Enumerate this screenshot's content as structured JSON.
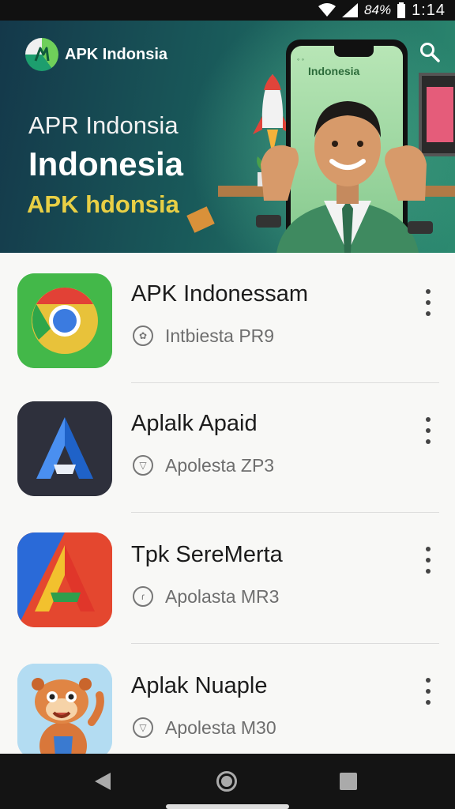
{
  "status_bar": {
    "battery": "84%",
    "time": "1:14"
  },
  "banner": {
    "brand": "APK Indonsia",
    "line1": "APR Indonsia",
    "line2": "Indonesia",
    "line3": "APK hdonsia",
    "phone_brand": "Indonesia",
    "accent": "#e8cf45"
  },
  "apps": [
    {
      "title": "APK Indonessam",
      "subtitle": "Intbiesta PR9",
      "icon": "chrome-icon"
    },
    {
      "title": "Aplalk Apaid",
      "subtitle": "Apolesta ZP3",
      "icon": "letter-a-blue-icon"
    },
    {
      "title": "Tpk SereMerta",
      "subtitle": "Apolasta MR3",
      "icon": "letter-a-multicolor-icon"
    },
    {
      "title": "Aplak Nuaple",
      "subtitle": "Apolesta M30",
      "icon": "cartoon-otter-icon"
    }
  ]
}
